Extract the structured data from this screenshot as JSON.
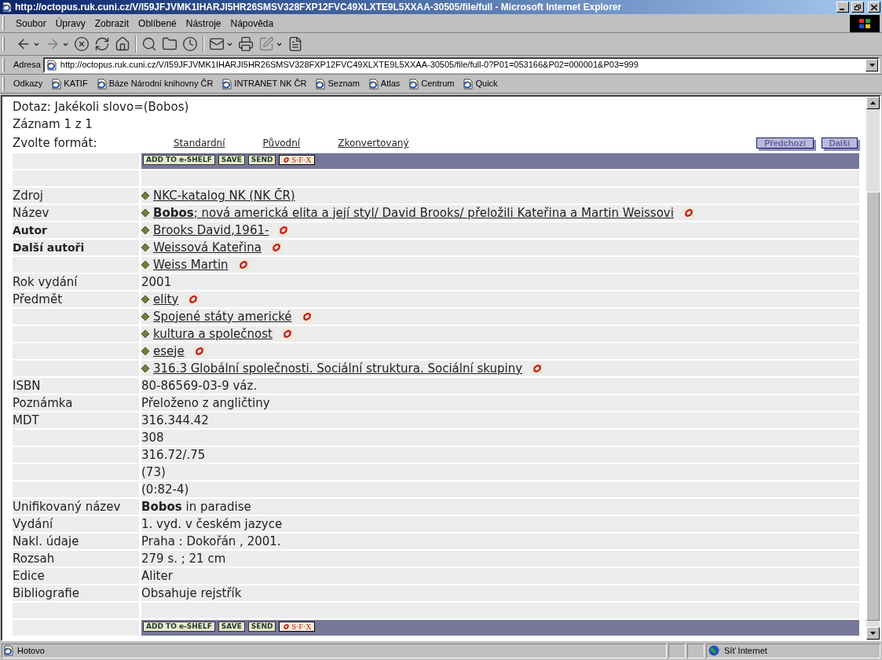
{
  "window": {
    "title": "http://octopus.ruk.cuni.cz/V/I59JFJVMK1IHARJI5HR26SMSV328FXP12FVC49XLXTE9L5XXAA-30505/file/full - Microsoft Internet Explorer"
  },
  "menu": [
    "Soubor",
    "Úpravy",
    "Zobrazit",
    "Oblíbené",
    "Nástroje",
    "Nápověda"
  ],
  "address": {
    "label": "Adresa",
    "value": "http://octopus.ruk.cuni.cz/V/I59JFJVMK1IHARJI5HR26SMSV328FXP12FVC49XLXTE9L5XXAA-30505/file/full-0?P01=053166&P02=000001&P03=999"
  },
  "links": {
    "label": "Odkazy",
    "items": [
      "KATIF",
      "Báze Národní knihovny ČR",
      "INTRANET NK ČR",
      "Seznam",
      "Atlas",
      "Centrum",
      "Quick"
    ]
  },
  "page": {
    "query": "Dotaz: Jakékoli slovo=(Bobos)",
    "record": "Záznam 1 z 1",
    "format_label": "Zvolte formát:",
    "formats": [
      "Standardní",
      "Původní",
      "Zkonvertovaný"
    ],
    "nav": [
      "Předchozí",
      "Další"
    ],
    "actions_top": [
      {
        "kind": "text",
        "label": "ADD TO e-SHELF"
      },
      {
        "kind": "text",
        "label": "SAVE"
      },
      {
        "kind": "text",
        "label": "SEND"
      },
      {
        "kind": "sfx",
        "label": "S·F·X"
      }
    ],
    "actions_bottom": [
      {
        "kind": "text",
        "label": "ADD TO e-SHELF"
      },
      {
        "kind": "text",
        "label": "SAVE"
      },
      {
        "kind": "text",
        "label": "SEND"
      },
      {
        "kind": "sfx",
        "label": "S·F·X"
      }
    ],
    "rows": [
      {
        "label": "Zdroj",
        "bold": false,
        "kind": "link",
        "value": "NKC-katalog NK (NK ČR)",
        "sfx": false
      },
      {
        "label": "Název",
        "bold": false,
        "kind": "link",
        "value": "**Bobos**; nová americká elita a její styl/ David Brooks/ přeložili Kateřina a Martin Weissovi",
        "sfx": true
      },
      {
        "label": "Autor",
        "bold": true,
        "kind": "link",
        "value": "Brooks David,1961-",
        "sfx": true
      },
      {
        "label": "Další autoři",
        "bold": true,
        "kind": "link",
        "value": "Weissová Kateřina",
        "sfx": true
      },
      {
        "kind": "link",
        "value": "Weiss Martin",
        "sfx": true
      },
      {
        "label": "Rok vydání",
        "bold": false,
        "kind": "text",
        "value": "2001"
      },
      {
        "label": "Předmět",
        "bold": false,
        "kind": "link",
        "value": "elity",
        "sfx": true
      },
      {
        "kind": "link",
        "value": "Spojené státy americké",
        "sfx": true
      },
      {
        "kind": "link",
        "value": "kultura a společnost",
        "sfx": true
      },
      {
        "kind": "link",
        "value": "eseje",
        "sfx": true
      },
      {
        "kind": "link",
        "value": "316.3 Globální společnosti. Sociální struktura. Sociální skupiny",
        "sfx": true
      },
      {
        "label": "ISBN",
        "bold": false,
        "kind": "text",
        "value": "80-86569-03-9 váz."
      },
      {
        "label": "Poznámka",
        "bold": false,
        "kind": "text",
        "value": "Přeloženo z angličtiny"
      },
      {
        "label": "MDT",
        "bold": false,
        "kind": "text",
        "value": "316.344.42"
      },
      {
        "kind": "text",
        "value": "308"
      },
      {
        "kind": "text",
        "value": "316.72/.75"
      },
      {
        "kind": "text",
        "value": "(73)"
      },
      {
        "kind": "text",
        "value": "(0:82-4)"
      },
      {
        "label": "Unifikovaný název",
        "bold": false,
        "kind": "text",
        "value": "**Bobos** in paradise"
      },
      {
        "label": "Vydání",
        "bold": false,
        "kind": "text",
        "value": "1. vyd. v českém jazyce"
      },
      {
        "label": "Nakl. údaje",
        "bold": false,
        "kind": "text",
        "value": "Praha : Dokořán , 2001."
      },
      {
        "label": "Rozsah",
        "bold": false,
        "kind": "text",
        "value": "279 s. ; 21 cm"
      },
      {
        "label": "Edice",
        "bold": false,
        "kind": "text",
        "value": "Aliter"
      },
      {
        "label": "Bibliografie",
        "bold": false,
        "kind": "text",
        "value": "Obsahuje rejstřík"
      }
    ]
  },
  "status_bar": {
    "text": "Hotovo",
    "zone": "Síť Internet"
  }
}
